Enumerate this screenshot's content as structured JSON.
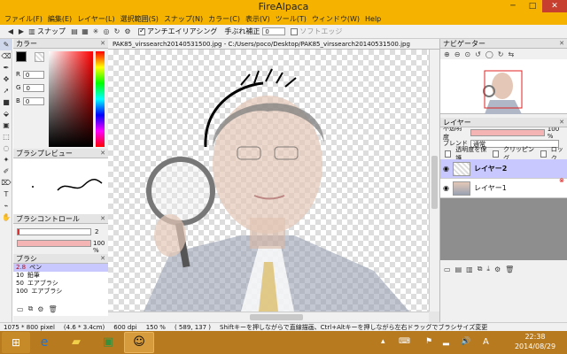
{
  "window": {
    "title": "FireAlpaca",
    "minimize": "─",
    "maximize": "□",
    "close": "✕"
  },
  "menu": [
    "ファイル(F)",
    "編集(E)",
    "レイヤー(L)",
    "選択範囲(S)",
    "スナップ(N)",
    "カラー(C)",
    "表示(V)",
    "ツール(T)",
    "ウィンドウ(W)",
    "Help"
  ],
  "toolbar": {
    "snap_label": "スナップ",
    "antialias_label": "アンチエイリアシング",
    "stabilizer_label": "手ぶれ補正",
    "stabilizer_value": "0",
    "soft_edge_label": "ソフトエッジ"
  },
  "color_panel": {
    "title": "カラー",
    "labels": [
      "R",
      "G",
      "B"
    ],
    "values": [
      "0",
      "0",
      "0"
    ]
  },
  "brush_preview": {
    "title": "ブラシプレビュー"
  },
  "brush_control": {
    "title": "ブラシコントロール",
    "size": "2",
    "opacity": "100 %"
  },
  "brush_panel": {
    "title": "ブラシ",
    "items": [
      {
        "size": "2.8",
        "name": "ペン",
        "selected": true
      },
      {
        "size": "10",
        "name": "鉛筆",
        "selected": false
      },
      {
        "size": "50",
        "name": "エアブラシ",
        "selected": false
      },
      {
        "size": "100",
        "name": "エアブラシ",
        "selected": false
      }
    ]
  },
  "document": {
    "tab": "PAK85_virssearch20140531500.jpg - C:/Users/poco/Desktop/PAK85_virssearch20140531500.jpg"
  },
  "navigator": {
    "title": "ナビゲーター"
  },
  "layer_panel": {
    "title": "レイヤー",
    "opacity_label": "不透明度",
    "opacity_value": "100 %",
    "blend_label": "ブレンド",
    "blend_value": "通常",
    "protect_label": "透明度を保護",
    "clipping_label": "クリッピング",
    "lock_label": "ロック",
    "layers": [
      {
        "name": "レイヤー2",
        "selected": true
      },
      {
        "name": "レイヤー1",
        "selected": false
      }
    ]
  },
  "status": {
    "size": "1075 * 800 pixel",
    "physical": "(4.6 * 3.4cm)",
    "dpi": "600 dpi",
    "zoom": "150 %",
    "coords": "( 589, 137 )",
    "hint": "Shiftキーを押しながらで直線描画、Ctrl+Altキーを押しながら左右ドラッグでブラシサイズ変更"
  },
  "taskbar": {
    "time": "22:38",
    "date": "2014/08/29",
    "ime": "A"
  },
  "colors": {
    "titlebar": "#f5b300",
    "taskbar": "#b77a1e",
    "layer_selected": "#c8c8ff"
  }
}
